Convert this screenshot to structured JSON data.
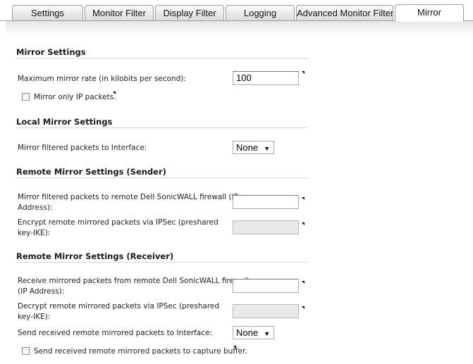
{
  "tabs": [
    {
      "label": "Settings",
      "active": false
    },
    {
      "label": "Monitor Filter",
      "active": false
    },
    {
      "label": "Display Filter",
      "active": false
    },
    {
      "label": "Logging",
      "active": false
    },
    {
      "label": "Advanced Monitor Filter",
      "active": false
    },
    {
      "label": "Mirror",
      "active": true
    }
  ],
  "mirror_settings": {
    "title": "Mirror Settings",
    "max_rate_label": "Maximum mirror rate (in kilobits per second):",
    "max_rate_value": "100",
    "mirror_ip_only_label": "Mirror only IP packets.",
    "mirror_ip_only_checked": false
  },
  "local_mirror": {
    "title": "Local Mirror Settings",
    "interface_label": "Mirror filtered packets to Interface:",
    "interface_value": "None"
  },
  "remote_sender": {
    "title": "Remote Mirror Settings (Sender)",
    "ip_label_1": "Mirror filtered packets to remote Dell SonicWALL firewall (IP",
    "ip_label_2": "Address):",
    "ip_value": "",
    "ipsec_label_1": "Encrypt remote mirrored packets via IPSec (preshared",
    "ipsec_label_2": "key-IKE):",
    "ipsec_value": ""
  },
  "remote_receiver": {
    "title": "Remote Mirror Settings (Receiver)",
    "ip_label_1": "Receive mirrored packets from remote Dell SonicWALL firewall",
    "ip_label_2": "(IP Address):",
    "ip_value": "",
    "ipsec_label_1": "Decrypt remote mirrored packets via IPSec (preshared",
    "ipsec_label_2": "key-IKE):",
    "ipsec_value": "",
    "interface_label": "Send received remote mirrored packets to Interface:",
    "interface_value": "None",
    "capture_label": "Send received remote mirrored packets to capture buffer.",
    "capture_checked": false
  },
  "colors": {
    "tab_border": "#9c9c9c",
    "rule": "#d7d7d7",
    "disabled_input": "#e9e9e9"
  }
}
